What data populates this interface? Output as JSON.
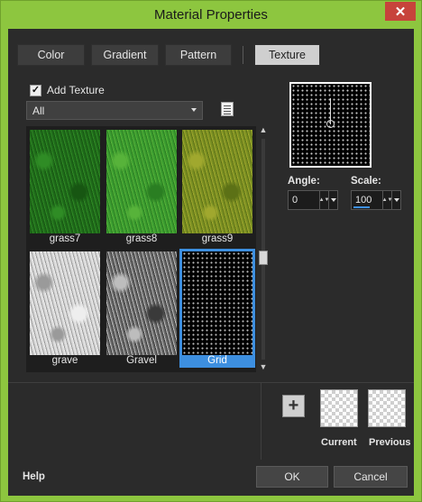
{
  "window": {
    "title": "Material Properties",
    "close_glyph": "✕"
  },
  "tabs": [
    {
      "label": "Color"
    },
    {
      "label": "Gradient"
    },
    {
      "label": "Pattern"
    },
    {
      "label": "Texture",
      "active": true
    }
  ],
  "add_texture": {
    "label": "Add Texture",
    "checked": true
  },
  "category_select": {
    "value": "All"
  },
  "textures": [
    {
      "label": "grass7",
      "colors": [
        "#1f6a1a",
        "#2f8c25",
        "#175612"
      ]
    },
    {
      "label": "grass8",
      "colors": [
        "#3a9b2f",
        "#57b33a",
        "#2a7e22"
      ]
    },
    {
      "label": "grass9",
      "colors": [
        "#7a8f22",
        "#a0a82e",
        "#5c7116"
      ]
    },
    {
      "label": "grave",
      "colors": [
        "#d8d8d8",
        "#9a9a9a",
        "#eeeeee"
      ]
    },
    {
      "label": "Gravel",
      "colors": [
        "#6a6a6a",
        "#bdbdbd",
        "#3a3a3a"
      ]
    },
    {
      "label": "Grid",
      "colors": [
        "#000000",
        "#bdbdbd",
        "#000000"
      ],
      "selected": true
    }
  ],
  "angle": {
    "label": "Angle:",
    "value": "0"
  },
  "scale": {
    "label": "Scale:",
    "value": "100"
  },
  "swatches": {
    "current_label": "Current",
    "previous_label": "Previous",
    "add_glyph": "+"
  },
  "footer": {
    "help": "Help",
    "ok": "OK",
    "cancel": "Cancel"
  }
}
